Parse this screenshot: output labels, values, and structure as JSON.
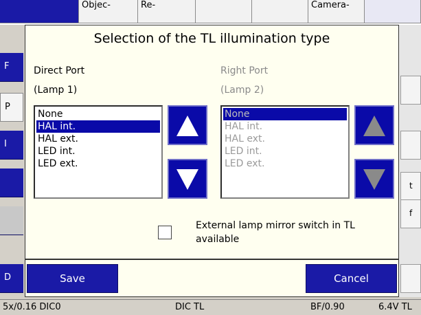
{
  "background": {
    "tabs": [
      "",
      "Objec-",
      "Re-",
      "",
      "",
      "Camera-"
    ],
    "left_buttons": [
      "F",
      "P",
      "I",
      "",
      "",
      "D"
    ],
    "right_buttons": [
      "t",
      "f"
    ]
  },
  "status_bar": {
    "objective": "5x/0.16 DIC0",
    "mode": "DIC TL",
    "filter": "BF/0.90",
    "voltage": "6.4V TL"
  },
  "dialog": {
    "title": "Selection of the TL illumination type",
    "direct_port": {
      "label": "Direct Port",
      "sublabel": "(Lamp 1)",
      "options": [
        "None",
        "HAL int.",
        "HAL ext.",
        "LED int.",
        "LED ext."
      ],
      "selected": "HAL int."
    },
    "right_port": {
      "label": "Right Port",
      "sublabel": "(Lamp 2)",
      "options": [
        "None",
        "HAL int.",
        "HAL ext.",
        "LED int.",
        "LED ext."
      ],
      "selected": "None",
      "disabled": true
    },
    "mirror_switch": {
      "label": "External lamp mirror switch in TL available",
      "checked": false
    },
    "buttons": {
      "save": "Save",
      "cancel": "Cancel"
    }
  },
  "colors": {
    "accent": "#1a1aa6",
    "selection": "#0a0aa8",
    "dialog_bg": "#fffff0",
    "disabled_arrow": "#8a8a8a"
  }
}
